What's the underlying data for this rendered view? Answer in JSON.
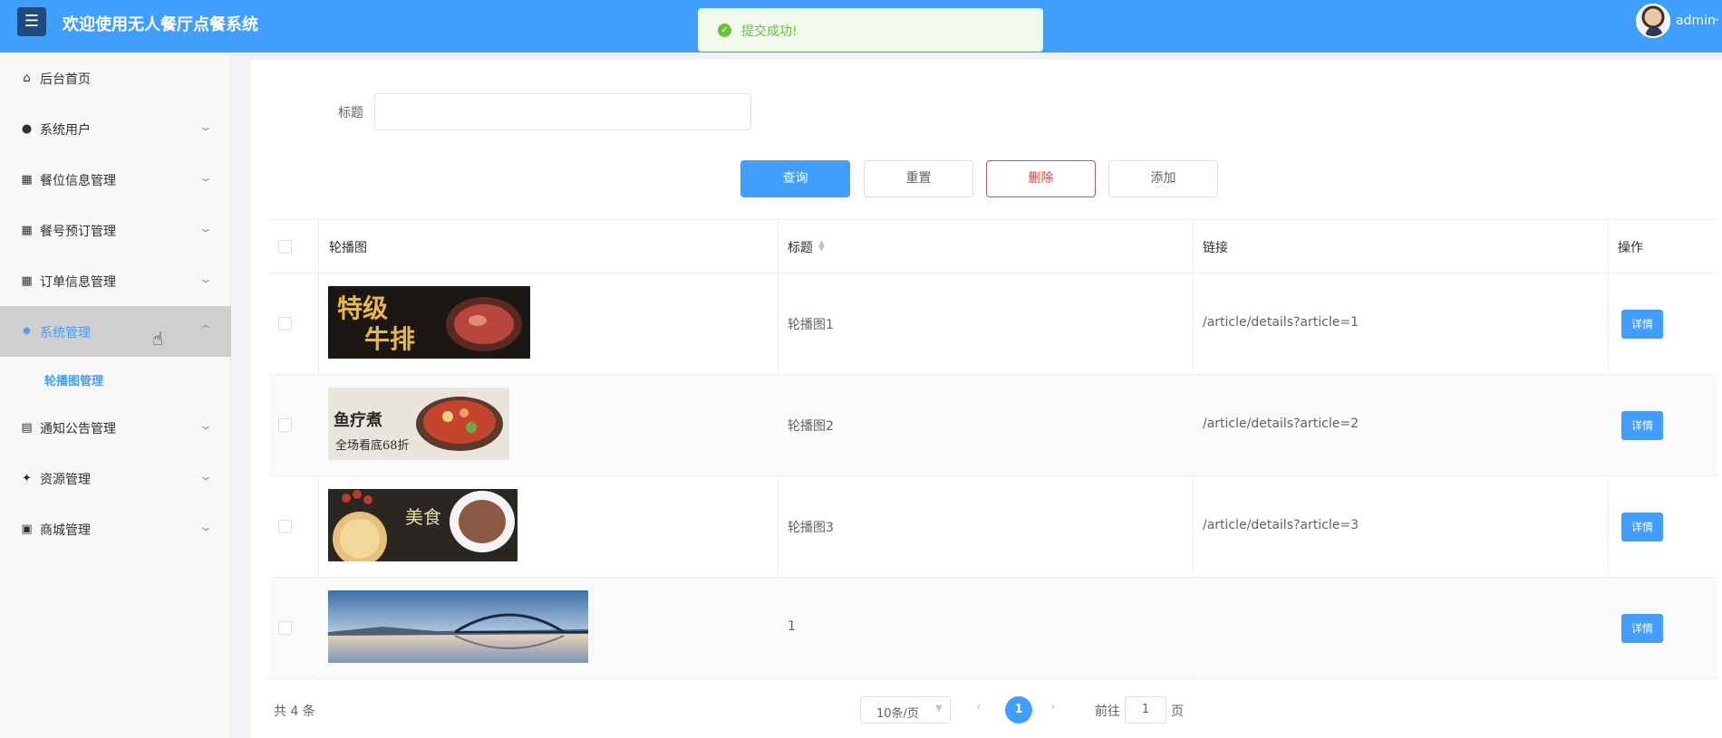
{
  "header": {
    "menu_icon": "☰",
    "title": "欢迎使用无人餐厅点餐系统",
    "user": "admin",
    "caret": "⌄"
  },
  "toast": {
    "icon": "✓",
    "message": "提交成功!"
  },
  "sidebar": {
    "items": [
      {
        "label": "后台首页",
        "icon": "home-icon",
        "glyph": "⌂",
        "has_children": false
      },
      {
        "label": "系统用户",
        "icon": "user-icon",
        "glyph": "●",
        "has_children": true
      },
      {
        "label": "餐位信息管理",
        "icon": "grid-icon",
        "glyph": "▦",
        "has_children": true
      },
      {
        "label": "餐号预订管理",
        "icon": "grid-icon",
        "glyph": "▦",
        "has_children": true
      },
      {
        "label": "订单信息管理",
        "icon": "grid-icon",
        "glyph": "▦",
        "has_children": true
      },
      {
        "label": "系统管理",
        "icon": "gear-icon",
        "glyph": "✹",
        "has_children": true,
        "active": true
      },
      {
        "label": "通知公告管理",
        "icon": "document-icon",
        "glyph": "▤",
        "has_children": true
      },
      {
        "label": "资源管理",
        "icon": "compass-icon",
        "glyph": "✦",
        "has_children": true
      },
      {
        "label": "商城管理",
        "icon": "shop-icon",
        "glyph": "▣",
        "has_children": true
      }
    ],
    "sub_item": "轮播图管理",
    "chevron": "⌄",
    "chevron_up": "⌃"
  },
  "search": {
    "label": "标题",
    "value": ""
  },
  "buttons": {
    "query": "查询",
    "reset": "重置",
    "delete": "删除",
    "add": "添加"
  },
  "table": {
    "headers": {
      "image": "轮播图",
      "title": "标题",
      "link": "链接",
      "action": "操作"
    },
    "rows": [
      {
        "title": "轮播图1",
        "link": "/article/details?article=1",
        "action": "详情",
        "image": "steak-banner"
      },
      {
        "title": "轮播图2",
        "link": "/article/details?article=2",
        "action": "详情",
        "image": "hotpot-banner"
      },
      {
        "title": "轮播图3",
        "link": "/article/details?article=3",
        "action": "详情",
        "image": "food-banner"
      },
      {
        "title": "1",
        "link": "",
        "action": "详情",
        "image": "bridge-photo"
      }
    ]
  },
  "pagination": {
    "total": "共 4 条",
    "page_size": "10条/页",
    "current": "1",
    "prev": "‹",
    "next": "›",
    "goto_prefix": "前往",
    "goto_value": "1",
    "goto_suffix": "页"
  },
  "colors": {
    "primary": "#409eff",
    "success": "#67c23a",
    "danger": "#e04545"
  }
}
